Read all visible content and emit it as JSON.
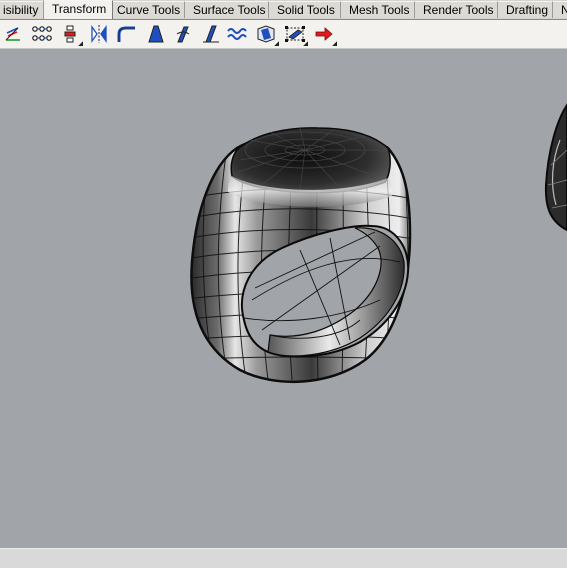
{
  "tabs": [
    {
      "label": "isibility"
    },
    {
      "label": "Transform"
    },
    {
      "label": "Curve Tools"
    },
    {
      "label": "Surface Tools"
    },
    {
      "label": "Solid Tools"
    },
    {
      "label": "Mesh Tools"
    },
    {
      "label": "Render Tools"
    },
    {
      "label": "Drafting"
    },
    {
      "label": "N"
    }
  ],
  "active_tab": "Transform",
  "toolbar_icons": [
    "move-to-plane-icon",
    "array-icon",
    "align-icon",
    "mirror-icon",
    "bend-icon",
    "taper-icon",
    "twist-icon",
    "flow-icon",
    "smooth-icon",
    "cage-edit-icon",
    "box-edit-icon",
    "red-arrow-icon"
  ],
  "colors": {
    "viewport_bg": "#a1a4a8",
    "tab_bg": "#d6d3ce",
    "toolbar_bg": "#f3f2ef",
    "accent_blue": "#1f4fbf",
    "accent_red": "#e11b1b"
  }
}
